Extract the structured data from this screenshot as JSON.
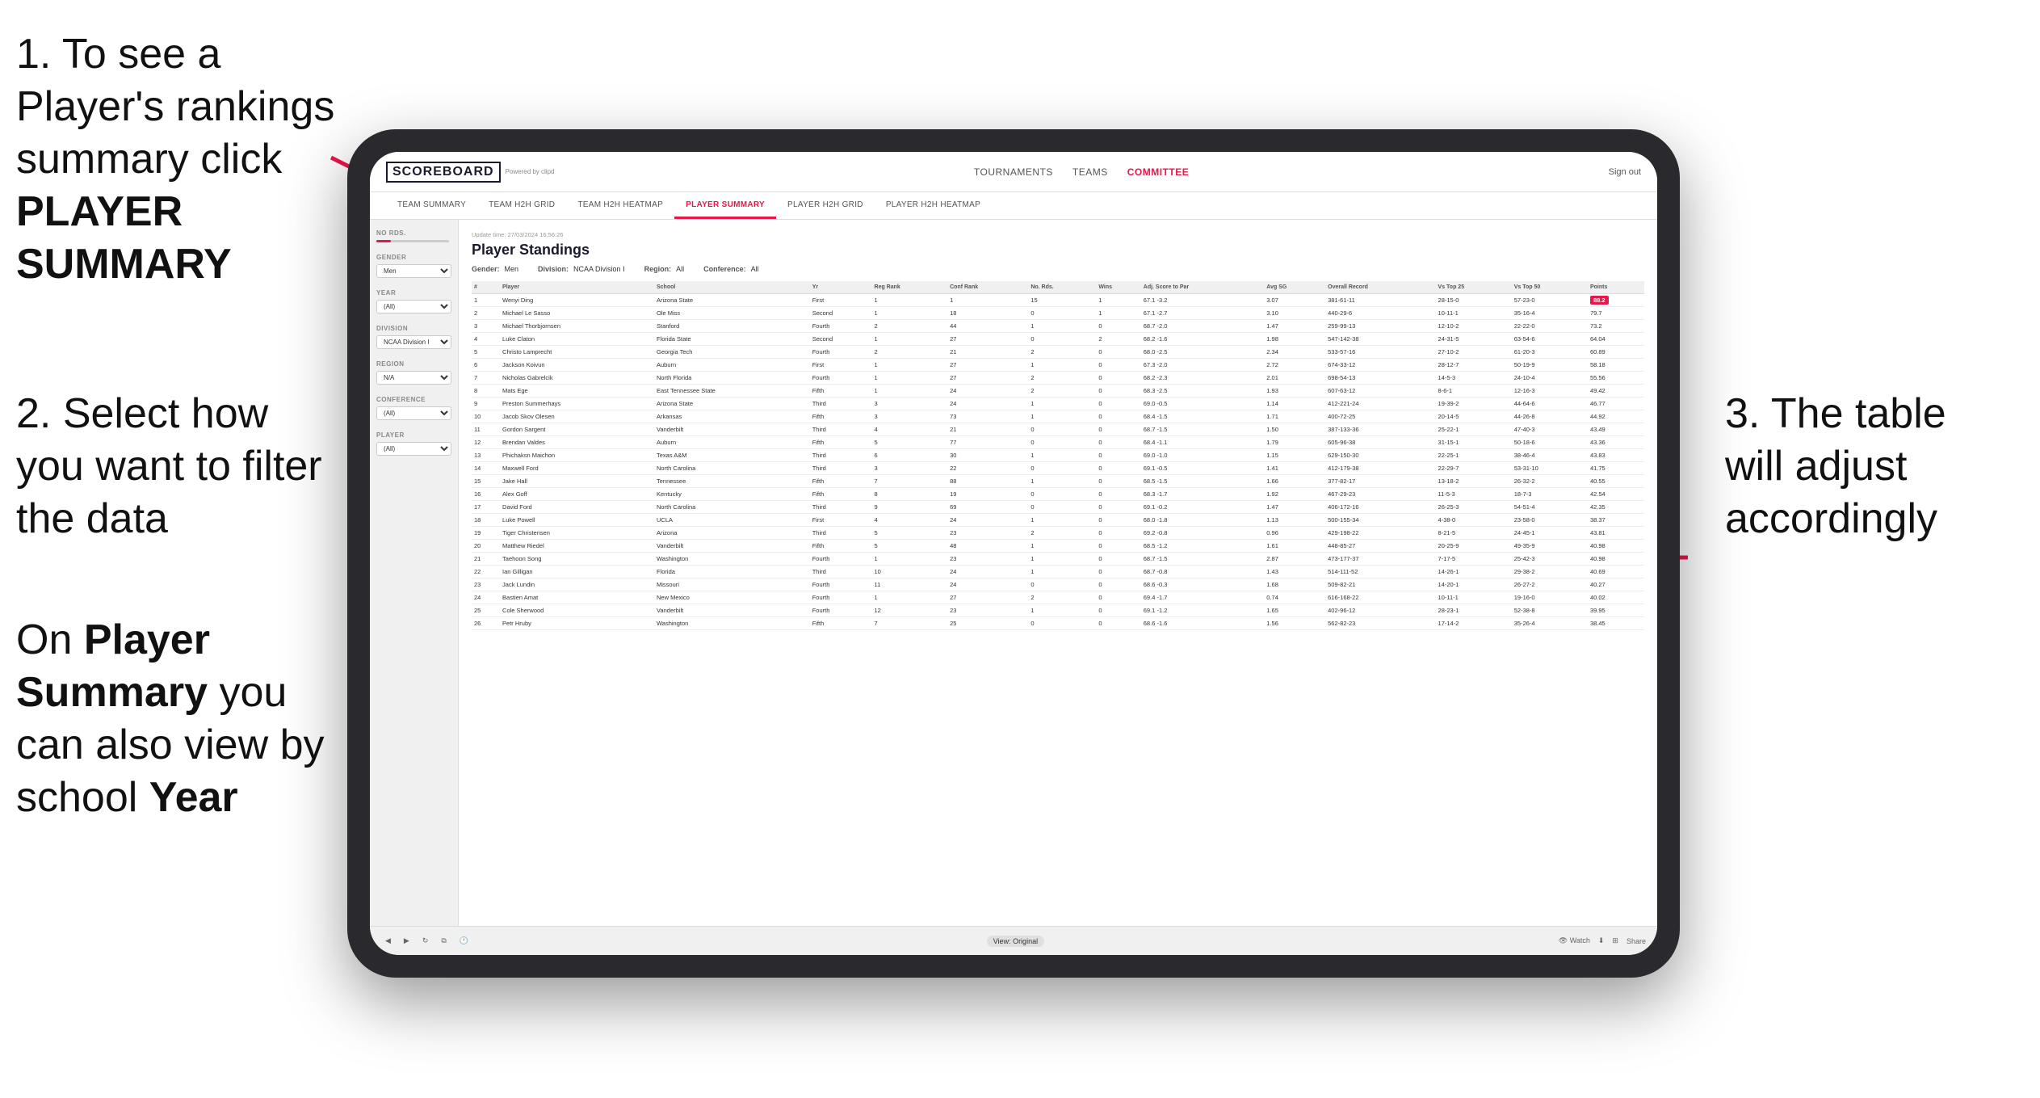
{
  "instructions": {
    "step1": {
      "number": "1.",
      "text_before": "To see a Player's rankings summary click ",
      "bold_text": "PLAYER SUMMARY"
    },
    "step2": {
      "number": "2.",
      "text_before": "Select how you want to filter the data"
    },
    "step3": {
      "text_before": "On ",
      "bold1": "Player Summary",
      "text_middle": " you can also view by school ",
      "bold2": "Year"
    },
    "step4_right": {
      "number": "3.",
      "text": "The table will adjust accordingly"
    }
  },
  "app": {
    "logo": "SCOREBOARD",
    "logo_sub": "Powered by clipd",
    "nav": {
      "links": [
        "TOURNAMENTS",
        "TEAMS",
        "COMMITTEE"
      ],
      "sign_out": "Sign out"
    },
    "sub_nav": [
      "TEAM SUMMARY",
      "TEAM H2H GRID",
      "TEAM H2H HEATMAP",
      "PLAYER SUMMARY",
      "PLAYER H2H GRID",
      "PLAYER H2H HEATMAP"
    ],
    "active_sub_nav": "PLAYER SUMMARY",
    "sidebar": {
      "no_rds_label": "No Rds.",
      "gender_label": "Gender",
      "gender_value": "Men",
      "year_label": "Year",
      "year_value": "(All)",
      "division_label": "Division",
      "division_value": "NCAA Division I",
      "region_label": "Region",
      "region_value": "N/A",
      "conference_label": "Conference",
      "conference_value": "(All)",
      "player_label": "Player",
      "player_value": "(All)"
    },
    "main": {
      "update_time": "Update time: 27/03/2024 16:56:26",
      "title": "Player Standings",
      "filters": {
        "gender_label": "Gender:",
        "gender_value": "Men",
        "division_label": "Division:",
        "division_value": "NCAA Division I",
        "region_label": "Region:",
        "region_value": "All",
        "conference_label": "Conference:",
        "conference_value": "All"
      },
      "table": {
        "headers": [
          "#",
          "Player",
          "School",
          "Yr",
          "Reg Rank",
          "Conf Rank",
          "No. Rds.",
          "Wins",
          "Adj. Score to Par",
          "Avg SG",
          "Overall Record",
          "Vs Top 25",
          "Vs Top 50",
          "Points"
        ],
        "rows": [
          [
            1,
            "Wenyi Ding",
            "Arizona State",
            "First",
            1,
            1,
            15,
            1,
            "67.1 -3.2",
            "3.07",
            "381-61-11",
            "28-15-0",
            "57-23-0",
            "88.2"
          ],
          [
            2,
            "Michael Le Sasso",
            "Ole Miss",
            "Second",
            1,
            18,
            0,
            1,
            "67.1 -2.7",
            "3.10",
            "440-29-6",
            "10-11-1",
            "35-16-4",
            "79.7"
          ],
          [
            3,
            "Michael Thorbjornsen",
            "Stanford",
            "Fourth",
            2,
            44,
            1,
            0,
            "68.7 -2.0",
            "1.47",
            "259-99-13",
            "12-10-2",
            "22-22-0",
            "73.2"
          ],
          [
            4,
            "Luke Claton",
            "Florida State",
            "Second",
            1,
            27,
            0,
            2,
            "68.2 -1.6",
            "1.98",
            "547-142-38",
            "24-31-5",
            "63-54-6",
            "64.04"
          ],
          [
            5,
            "Christo Lamprecht",
            "Georgia Tech",
            "Fourth",
            2,
            21,
            2,
            0,
            "68.0 -2.5",
            "2.34",
            "533-57-16",
            "27-10-2",
            "61-20-3",
            "60.89"
          ],
          [
            6,
            "Jackson Koivun",
            "Auburn",
            "First",
            1,
            27,
            1,
            0,
            "67.3 -2.0",
            "2.72",
            "674-33-12",
            "28-12-7",
            "50-19-9",
            "58.18"
          ],
          [
            7,
            "Nicholas Gabrelcik",
            "North Florida",
            "Fourth",
            1,
            27,
            2,
            0,
            "68.2 -2.3",
            "2.01",
            "698-54-13",
            "14-5-3",
            "24-10-4",
            "55.56"
          ],
          [
            8,
            "Mats Ege",
            "East Tennessee State",
            "Fifth",
            1,
            24,
            2,
            0,
            "68.3 -2.5",
            "1.93",
            "607-63-12",
            "8-6-1",
            "12-16-3",
            "49.42"
          ],
          [
            9,
            "Preston Summerhays",
            "Arizona State",
            "Third",
            3,
            24,
            1,
            0,
            "69.0 -0.5",
            "1.14",
            "412-221-24",
            "19-39-2",
            "44-64-6",
            "46.77"
          ],
          [
            10,
            "Jacob Skov Olesen",
            "Arkansas",
            "Fifth",
            3,
            73,
            1,
            0,
            "68.4 -1.5",
            "1.71",
            "400-72-25",
            "20-14-5",
            "44-26-8",
            "44.92"
          ],
          [
            11,
            "Gordon Sargent",
            "Vanderbilt",
            "Third",
            4,
            21,
            0,
            0,
            "68.7 -1.5",
            "1.50",
            "387-133-36",
            "25-22-1",
            "47-40-3",
            "43.49"
          ],
          [
            12,
            "Brendan Valdes",
            "Auburn",
            "Fifth",
            5,
            77,
            0,
            0,
            "68.4 -1.1",
            "1.79",
            "605-96-38",
            "31-15-1",
            "50-18-6",
            "43.36"
          ],
          [
            13,
            "Phichaksn Maichon",
            "Texas A&M",
            "Third",
            6,
            30,
            1,
            0,
            "69.0 -1.0",
            "1.15",
            "629-150-30",
            "22-25-1",
            "38-46-4",
            "43.83"
          ],
          [
            14,
            "Maxwell Ford",
            "North Carolina",
            "Third",
            3,
            22,
            0,
            0,
            "69.1 -0.5",
            "1.41",
            "412-179-38",
            "22-29-7",
            "53-31-10",
            "41.75"
          ],
          [
            15,
            "Jake Hall",
            "Tennessee",
            "Fifth",
            7,
            88,
            1,
            0,
            "68.5 -1.5",
            "1.66",
            "377-82-17",
            "13-18-2",
            "26-32-2",
            "40.55"
          ],
          [
            16,
            "Alex Goff",
            "Kentucky",
            "Fifth",
            8,
            19,
            0,
            0,
            "68.3 -1.7",
            "1.92",
            "467-29-23",
            "11-5-3",
            "18-7-3",
            "42.54"
          ],
          [
            17,
            "David Ford",
            "North Carolina",
            "Third",
            9,
            69,
            0,
            0,
            "69.1 -0.2",
            "1.47",
            "406-172-16",
            "26-25-3",
            "54-51-4",
            "42.35"
          ],
          [
            18,
            "Luke Powell",
            "UCLA",
            "First",
            4,
            24,
            1,
            0,
            "68.0 -1.8",
            "1.13",
            "500-155-34",
            "4-38-0",
            "23-58-0",
            "38.37"
          ],
          [
            19,
            "Tiger Christensen",
            "Arizona",
            "Third",
            5,
            23,
            2,
            0,
            "69.2 -0.8",
            "0.96",
            "429-198-22",
            "8-21-5",
            "24-45-1",
            "43.81"
          ],
          [
            20,
            "Matthew Riedel",
            "Vanderbilt",
            "Fifth",
            5,
            48,
            1,
            0,
            "68.5 -1.2",
            "1.61",
            "448-85-27",
            "20-25-9",
            "49-35-9",
            "40.98"
          ],
          [
            21,
            "Taehoon Song",
            "Washington",
            "Fourth",
            1,
            23,
            1,
            0,
            "68.7 -1.5",
            "2.87",
            "473-177-37",
            "7-17-5",
            "25-42-3",
            "40.98"
          ],
          [
            22,
            "Ian Gilligan",
            "Florida",
            "Third",
            10,
            24,
            1,
            0,
            "68.7 -0.8",
            "1.43",
            "514-111-52",
            "14-26-1",
            "29-38-2",
            "40.69"
          ],
          [
            23,
            "Jack Lundin",
            "Missouri",
            "Fourth",
            11,
            24,
            0,
            0,
            "68.6 -0.3",
            "1.68",
            "509-82-21",
            "14-20-1",
            "26-27-2",
            "40.27"
          ],
          [
            24,
            "Bastien Amat",
            "New Mexico",
            "Fourth",
            1,
            27,
            2,
            0,
            "69.4 -1.7",
            "0.74",
            "616-168-22",
            "10-11-1",
            "19-16-0",
            "40.02"
          ],
          [
            25,
            "Cole Sherwood",
            "Vanderbilt",
            "Fourth",
            12,
            23,
            1,
            0,
            "69.1 -1.2",
            "1.65",
            "402-96-12",
            "28-23-1",
            "52-38-8",
            "39.95"
          ],
          [
            26,
            "Petr Hruby",
            "Washington",
            "Fifth",
            7,
            25,
            0,
            0,
            "68.6 -1.6",
            "1.56",
            "562-82-23",
            "17-14-2",
            "35-26-4",
            "38.45"
          ]
        ]
      },
      "toolbar": {
        "view_label": "View: Original",
        "watch_label": "Watch",
        "share_label": "Share"
      }
    }
  }
}
